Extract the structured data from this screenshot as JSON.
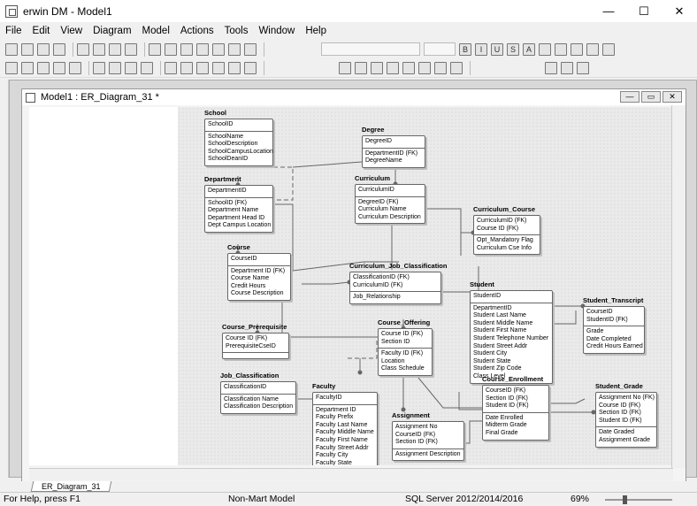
{
  "window": {
    "title": "erwin DM - Model1",
    "minimize": "—",
    "maximize": "☐",
    "close": "✕"
  },
  "menu": [
    "File",
    "Edit",
    "View",
    "Diagram",
    "Model",
    "Actions",
    "Tools",
    "Window",
    "Help"
  ],
  "mdi": {
    "title": "Model1 : ER_Diagram_31 *"
  },
  "tab": {
    "label": "ER_Diagram_31"
  },
  "status": {
    "help": "For Help, press F1",
    "model_type": "Non-Mart Model",
    "target_db": "SQL Server 2012/2014/2016",
    "zoom": "69%"
  },
  "entities": [
    {
      "id": "school",
      "title": "School",
      "pk": [
        "SchoolID"
      ],
      "attrs": [
        "SchoolName",
        "SchoolDescription",
        "SchoolCampusLocation",
        "SchoolDeanID"
      ]
    },
    {
      "id": "degree",
      "title": "Degree",
      "pk": [
        "DegreeID"
      ],
      "attrs": [
        "DepartmentID (FK)",
        "DegreeName"
      ]
    },
    {
      "id": "department",
      "title": "Department",
      "pk": [
        "DepartmentID"
      ],
      "attrs": [
        "SchoolID (FK)",
        "Department Name",
        "Department Head ID",
        "Dept Campus Location"
      ]
    },
    {
      "id": "curriculum",
      "title": "Curriculum",
      "pk": [
        "CurriculumID"
      ],
      "attrs": [
        "DegreeID (FK)",
        "Curriculum Name",
        "Curriculum Description"
      ]
    },
    {
      "id": "curriculum_course",
      "title": "Curriculum_Course",
      "pk": [
        "CurriculumID (FK)",
        "Course ID (FK)"
      ],
      "attrs": [
        "Opt_Mandatory Flag",
        "Curriculum Cse Info"
      ]
    },
    {
      "id": "course",
      "title": "Course",
      "pk": [
        "CourseID"
      ],
      "attrs": [
        "Department ID (FK)",
        "Course Name",
        "Credit Hours",
        "Course Description"
      ]
    },
    {
      "id": "cjc",
      "title": "Curriculum_Job_Classification",
      "pk": [
        "ClassificationID (FK)",
        "CurriculumID (FK)"
      ],
      "attrs": [
        "Job_Relationship"
      ]
    },
    {
      "id": "student",
      "title": "Student",
      "pk": [
        "StudentID"
      ],
      "attrs": [
        "DepartmentID",
        "Student Last Name",
        "Student Middle Name",
        "Student First Name",
        "Student Telephone Number",
        "Student Street Addr",
        "Student City",
        "Student State",
        "Student Zip Code",
        "Class Level"
      ]
    },
    {
      "id": "student_transcript",
      "title": "Student_Transcript",
      "pk": [
        "CourseID",
        "StudentID (FK)"
      ],
      "attrs": [
        "Grade",
        "Date Completed",
        "Credit Hours Earned"
      ]
    },
    {
      "id": "course_prereq",
      "title": "Course_Prerequisite",
      "pk": [
        "Course ID (FK)",
        "PrerequisiteCseID"
      ],
      "attrs": []
    },
    {
      "id": "course_offering",
      "title": "Course_Offering",
      "pk": [
        "Course ID (FK)",
        "Section ID"
      ],
      "attrs": [
        "Faculty ID (FK)",
        "Location",
        "Class Schedule"
      ]
    },
    {
      "id": "job_classification",
      "title": "Job_Classification",
      "pk": [
        "ClassificationID"
      ],
      "attrs": [
        "Classification Name",
        "Classification Description"
      ]
    },
    {
      "id": "faculty",
      "title": "Faculty",
      "pk": [
        "FacultyID"
      ],
      "attrs": [
        "Department ID",
        "Faculty Prefix",
        "Faculty Last Name",
        "Faculty Middle Name",
        "Faculty First Name",
        "Faculty Street Addr",
        "Faculty City",
        "Faculty State"
      ]
    },
    {
      "id": "course_enrollment",
      "title": "Course_Enrollment",
      "pk": [
        "CourseID (FK)",
        "Section ID (FK)",
        "Student ID (FK)"
      ],
      "attrs": [
        "Date Enrolled",
        "Midterm Grade",
        "Final Grade"
      ]
    },
    {
      "id": "assignment",
      "title": "Assignment",
      "pk": [
        "Assignment No",
        "CourseID (FK)",
        "Section ID (FK)"
      ],
      "attrs": [
        "Assignment Description"
      ]
    },
    {
      "id": "student_grade",
      "title": "Student_Grade",
      "pk": [
        "Assignment No (FK)",
        "Course ID (FK)",
        "Section ID (FK)",
        "Student ID (FK)"
      ],
      "attrs": [
        "Date Graded",
        "Assignment Grade"
      ]
    }
  ]
}
